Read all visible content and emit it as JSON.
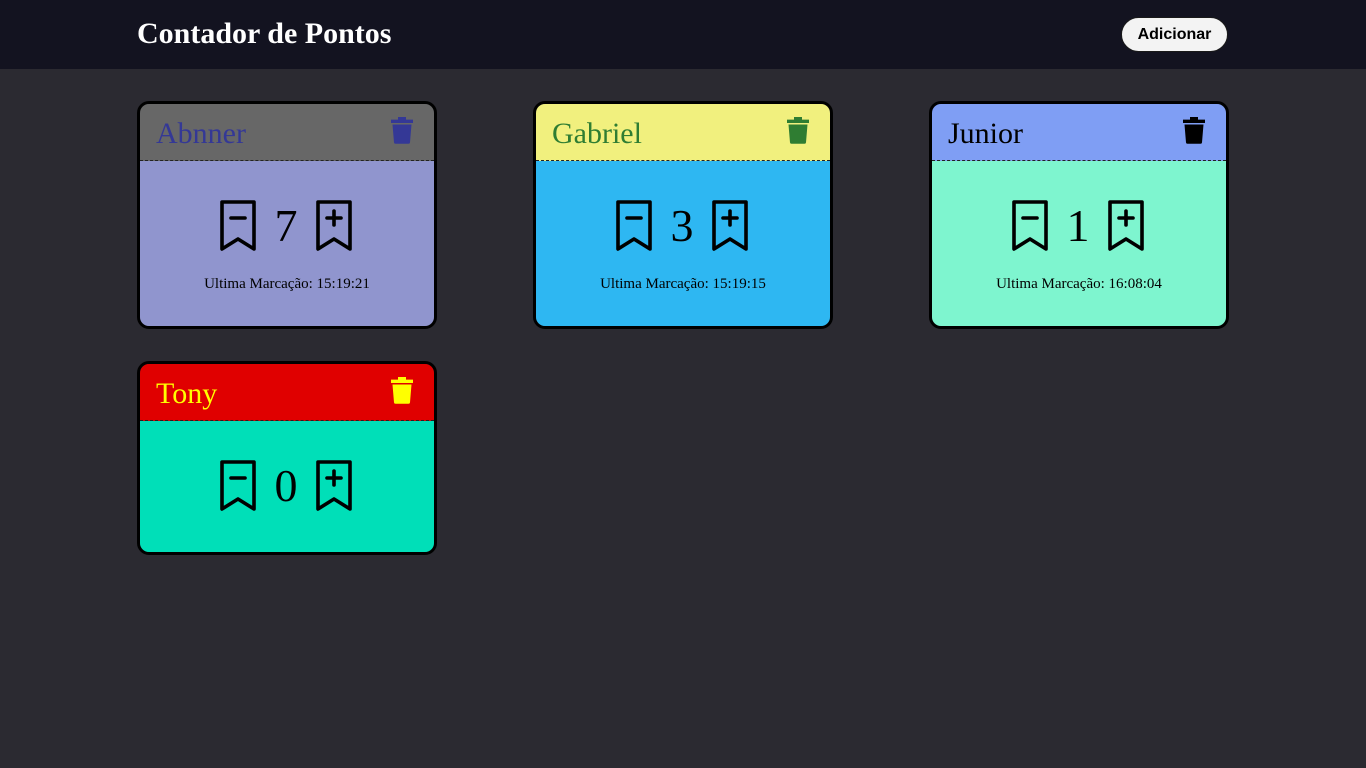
{
  "header": {
    "title": "Contador de Pontos",
    "add_label": "Adicionar"
  },
  "cards": [
    {
      "name": "Abnner",
      "count": "7",
      "last_mark_label": "Ultima Marcação:",
      "last_mark_time": "15:19:21",
      "last_mark": "Ultima Marcação: 15:19:21",
      "header_color": "#676767",
      "body_color": "#9095ce",
      "text_color": "#343896",
      "icon": "trash-icon"
    },
    {
      "name": "Gabriel",
      "count": "3",
      "last_mark_label": "Ultima Marcação:",
      "last_mark_time": "15:19:15",
      "last_mark": "Ultima Marcação: 15:19:15",
      "header_color": "#f1f07e",
      "body_color": "#2eb7f2",
      "text_color": "#2f7d32",
      "icon": "trash-icon"
    },
    {
      "name": "Junior",
      "count": "1",
      "last_mark_label": "Ultima Marcação:",
      "last_mark_time": "16:08:04",
      "last_mark": "Ultima Marcação: 16:08:04",
      "header_color": "#7f9ef4",
      "body_color": "#7ef5cf",
      "text_color": "#000000",
      "icon": "trash-icon"
    },
    {
      "name": "Tony",
      "count": "0",
      "last_mark_label": "",
      "last_mark_time": "",
      "last_mark": "",
      "header_color": "#e00000",
      "body_color": "#00dfb8",
      "text_color": "#ffff00",
      "icon": "trash-icon"
    }
  ],
  "icons": {
    "decrement": "bookmark-minus-icon",
    "increment": "bookmark-plus-icon"
  },
  "colors": {
    "page_background": "#2b2a31",
    "topbar_background": "#131320",
    "add_button_background": "#f3f3f3"
  }
}
